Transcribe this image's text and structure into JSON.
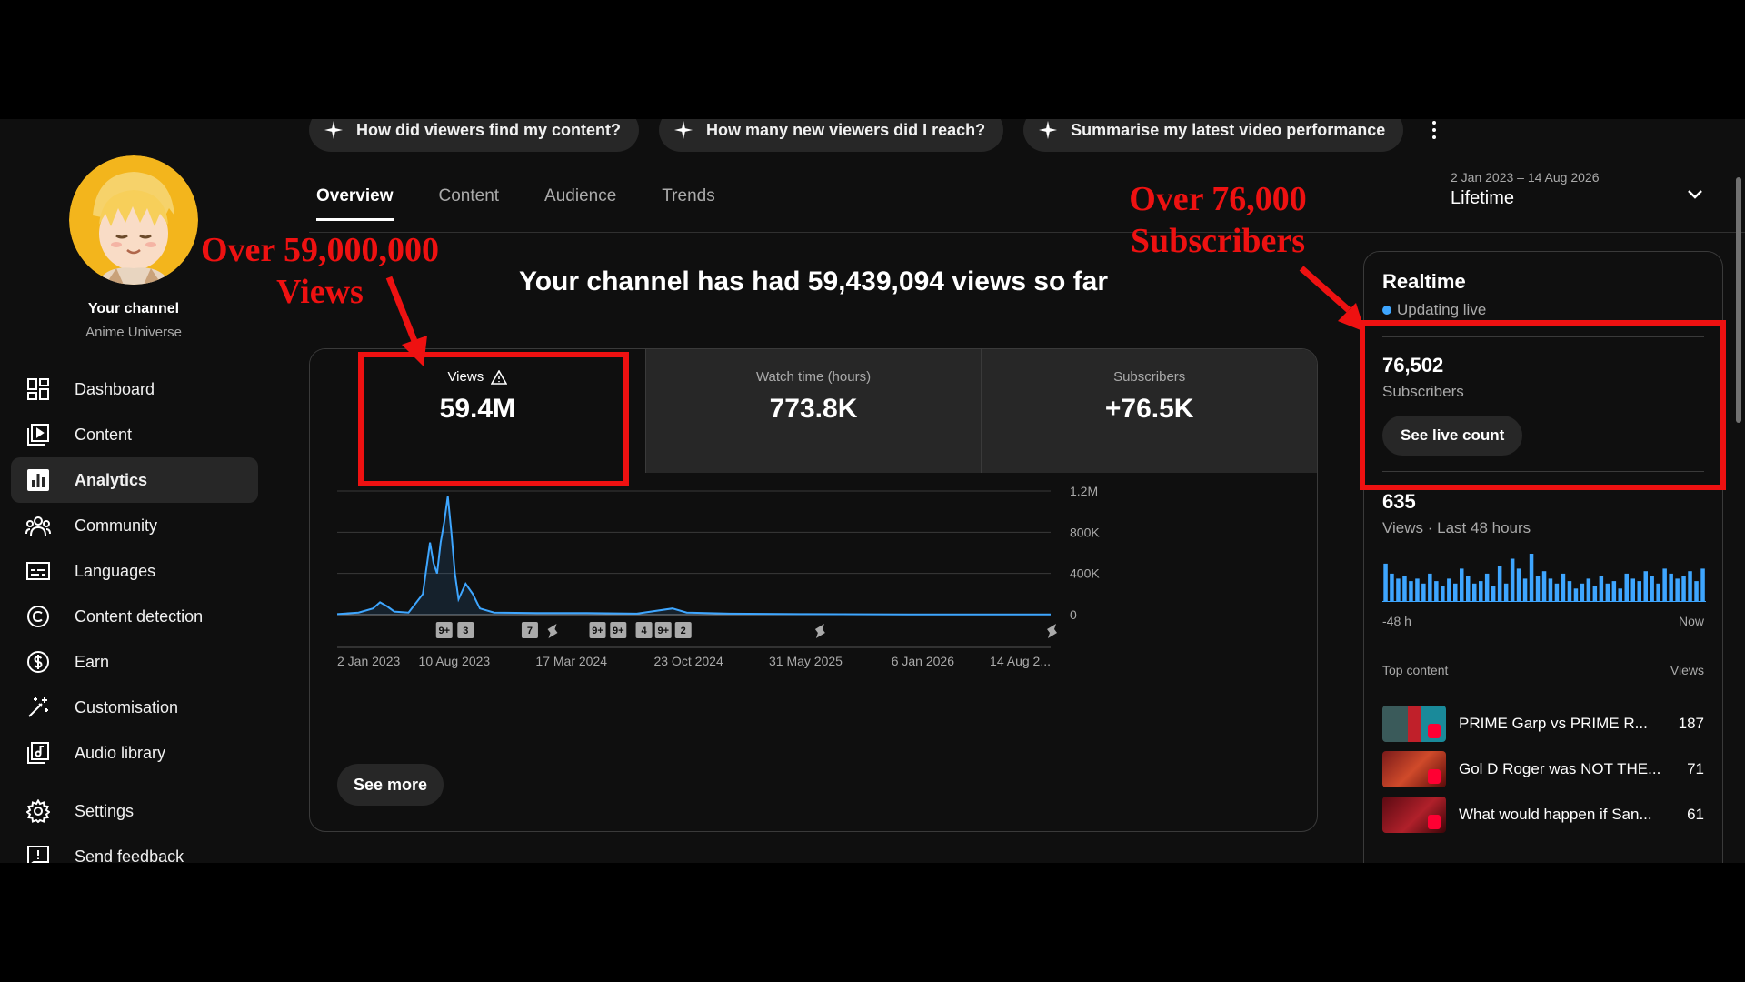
{
  "chips": [
    {
      "label": "How did viewers find my content?"
    },
    {
      "label": "How many new viewers did I reach?"
    },
    {
      "label": "Summarise my latest video performance"
    }
  ],
  "sidebar": {
    "your_channel": "Your channel",
    "channel_name": "Anime Universe",
    "items": [
      {
        "label": "Dashboard",
        "icon": "dashboard-icon"
      },
      {
        "label": "Content",
        "icon": "content-icon"
      },
      {
        "label": "Analytics",
        "icon": "analytics-icon",
        "active": true
      },
      {
        "label": "Community",
        "icon": "community-icon"
      },
      {
        "label": "Languages",
        "icon": "subtitles-icon"
      },
      {
        "label": "Content detection",
        "icon": "copyright-icon"
      },
      {
        "label": "Earn",
        "icon": "dollar-icon"
      },
      {
        "label": "Customisation",
        "icon": "magic-wand-icon"
      },
      {
        "label": "Audio library",
        "icon": "audio-library-icon"
      },
      {
        "label": "Settings",
        "icon": "gear-icon"
      },
      {
        "label": "Send feedback",
        "icon": "feedback-icon"
      }
    ]
  },
  "tabs": [
    "Overview",
    "Content",
    "Audience",
    "Trends"
  ],
  "date_picker": {
    "range": "2 Jan 2023 – 14 Aug 2026",
    "period": "Lifetime"
  },
  "headline": "Your channel has had 59,439,094 views so far",
  "metrics": [
    {
      "label": "Views",
      "value": "59.4M",
      "warning": true
    },
    {
      "label": "Watch time (hours)",
      "value": "773.8K"
    },
    {
      "label": "Subscribers",
      "value": "+76.5K"
    }
  ],
  "chart_data": {
    "type": "line",
    "title": "",
    "x_labels": [
      "2 Jan 2023",
      "10 Aug 2023",
      "17 Mar 2024",
      "23 Oct 2024",
      "31 May 2025",
      "6 Jan 2026",
      "14 Aug 2..."
    ],
    "y_ticks": [
      "0",
      "400K",
      "800K",
      "1.2M"
    ],
    "ylim": [
      0,
      1200000
    ],
    "series_color": "#3ea6ff",
    "series": [
      {
        "name": "Views",
        "points": [
          [
            0,
            5000
          ],
          [
            0.03,
            20000
          ],
          [
            0.05,
            60000
          ],
          [
            0.06,
            120000
          ],
          [
            0.07,
            80000
          ],
          [
            0.08,
            30000
          ],
          [
            0.1,
            20000
          ],
          [
            0.12,
            200000
          ],
          [
            0.13,
            700000
          ],
          [
            0.135,
            500000
          ],
          [
            0.14,
            400000
          ],
          [
            0.145,
            700000
          ],
          [
            0.15,
            900000
          ],
          [
            0.155,
            1150000
          ],
          [
            0.16,
            800000
          ],
          [
            0.165,
            400000
          ],
          [
            0.17,
            150000
          ],
          [
            0.18,
            300000
          ],
          [
            0.19,
            200000
          ],
          [
            0.2,
            60000
          ],
          [
            0.22,
            20000
          ],
          [
            0.28,
            15000
          ],
          [
            0.35,
            15000
          ],
          [
            0.42,
            10000
          ],
          [
            0.47,
            60000
          ],
          [
            0.49,
            20000
          ],
          [
            0.55,
            10000
          ],
          [
            0.65,
            5000
          ],
          [
            0.8,
            3000
          ],
          [
            0.9,
            2000
          ],
          [
            1.0,
            2000
          ]
        ]
      }
    ],
    "markers": [
      {
        "label": "9+",
        "x": 0.15
      },
      {
        "label": "3",
        "x": 0.18
      },
      {
        "label": "7",
        "x": 0.27
      },
      {
        "label": "shorts",
        "x": 0.3
      },
      {
        "label": "9+",
        "x": 0.365
      },
      {
        "label": "9+",
        "x": 0.394
      },
      {
        "label": "4",
        "x": 0.43
      },
      {
        "label": "9+",
        "x": 0.457
      },
      {
        "label": "2",
        "x": 0.485
      },
      {
        "label": "shorts",
        "x": 0.675
      },
      {
        "label": "shorts",
        "x": 1.0
      }
    ]
  },
  "see_more": "See more",
  "realtime": {
    "title": "Realtime",
    "status": "Updating live",
    "subscribers_value": "76,502",
    "subscribers_label": "Subscribers",
    "live_button": "See live count",
    "views_value": "635",
    "views_label": "Views · Last 48 hours",
    "spark_start": "-48 h",
    "spark_end": "Now",
    "spark_values": [
      30,
      22,
      18,
      20,
      16,
      18,
      14,
      22,
      16,
      12,
      18,
      14,
      26,
      20,
      14,
      16,
      22,
      12,
      28,
      14,
      34,
      26,
      18,
      38,
      20,
      24,
      18,
      14,
      22,
      16,
      10,
      14,
      18,
      12,
      20,
      14,
      16,
      10,
      22,
      18,
      16,
      24,
      20,
      14,
      26,
      22,
      18,
      20,
      24,
      16,
      26
    ],
    "top_content_label": "Top content",
    "views_col_label": "Views",
    "top_content": [
      {
        "title": "PRIME Garp vs PRIME R...",
        "views": "187"
      },
      {
        "title": "Gol D Roger was NOT THE...",
        "views": "71"
      },
      {
        "title": "What would happen if San...",
        "views": "61"
      }
    ]
  },
  "annotations": {
    "views_note": "Over 59,000,000 Views",
    "subs_note_line1": "Over 76,000",
    "subs_note_line2": "Subscribers",
    "color": "#ee1111"
  }
}
